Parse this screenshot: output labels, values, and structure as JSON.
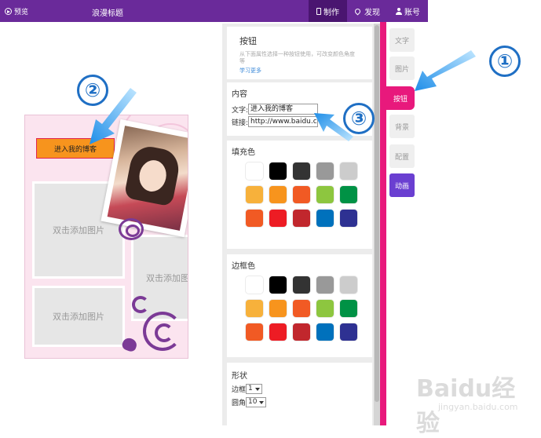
{
  "topbar": {
    "preview_label": "预览",
    "page_title": "浪漫标题",
    "nav": [
      {
        "label": "制作",
        "icon": "page-icon",
        "active": true
      },
      {
        "label": "发现",
        "icon": "location-pin-icon",
        "active": false
      },
      {
        "label": "账号",
        "icon": "user-icon",
        "active": false
      }
    ]
  },
  "canvas": {
    "button_text": "进入我的博客",
    "photo_slots": [
      "双击添加图片",
      "双击添加图",
      "双击添加图片"
    ]
  },
  "panel": {
    "component_title": "按钮",
    "component_desc": "从下面属性选择一种按钮使用，可改变颜色角度等",
    "learn_more": "学习更多",
    "content_title": "内容",
    "text_label": "文字:",
    "text_value": "进入我的博客",
    "link_label": "链接:",
    "link_value": "http://www.baidu.com",
    "fill_title": "填充色",
    "border_title": "边框色",
    "shape_title": "形状",
    "border_width_label": "边框",
    "border_width_value": "1",
    "radius_label": "圆角",
    "radius_value": "10",
    "palette": [
      "#ffffff",
      "#000000",
      "#333333",
      "#999999",
      "#cccccc",
      "#f7b13b",
      "#f7941d",
      "#f15a24",
      "#8dc63f",
      "#009245",
      "#f15a24",
      "#ed1c24",
      "#c1272d",
      "#0071bc",
      "#2e3192"
    ]
  },
  "tools": [
    "文字",
    "图片",
    "按钮",
    "背景",
    "配置",
    "动画"
  ],
  "active_tool": "按钮",
  "callouts": [
    "①",
    "②",
    "③"
  ],
  "accent_color": "#e8197c",
  "watermark": {
    "brand": "Baidu经验",
    "url": "jingyan.baidu.com"
  }
}
